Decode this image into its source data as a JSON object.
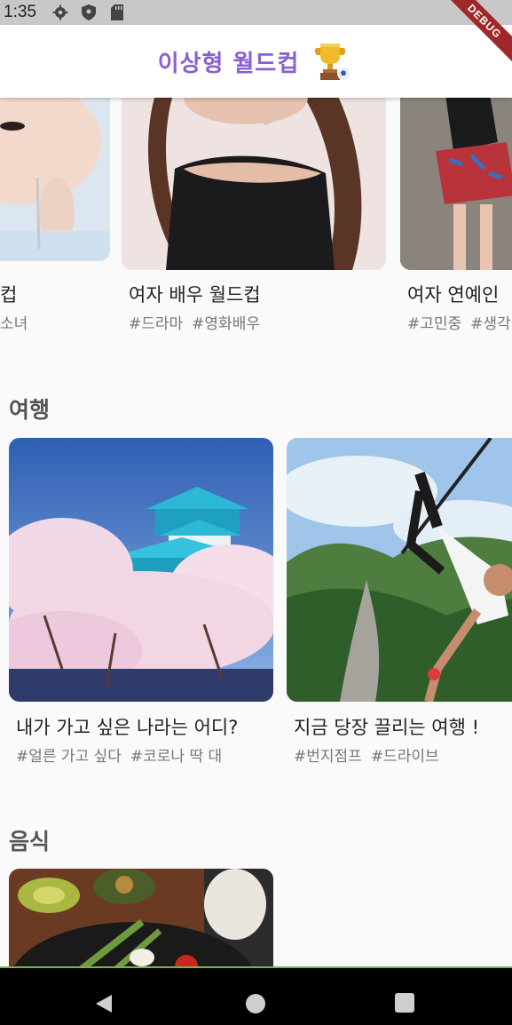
{
  "status_bar": {
    "time": "1:35",
    "icons": [
      "gear-icon",
      "shield-icon",
      "sd-card-icon"
    ]
  },
  "app_bar": {
    "title": "이상형 월드컵",
    "icon": "trophy-icon"
  },
  "debug_banner": "DEBUG",
  "colors": {
    "title": "#8a5fd0",
    "background": "#fafafa",
    "nav_accent": "#7cb342"
  },
  "top_row": [
    {
      "title": "컵",
      "tags": [
        "소녀"
      ]
    },
    {
      "title": "여자 배우 월드컵",
      "tags": [
        "#드라마",
        "#영화배우"
      ]
    },
    {
      "title": "여자 연예인",
      "tags": [
        "#고민중",
        "#생각"
      ]
    }
  ],
  "sections": [
    {
      "title": "여행",
      "cards": [
        {
          "title": "내가 가고 싶은 나라는 어디?",
          "tags": [
            "#얼른 가고 싶다",
            "#코로나 딱 대"
          ]
        },
        {
          "title": "지금 당장 끌리는 여행 !",
          "tags": [
            "#번지점프",
            "#드라이브"
          ]
        }
      ]
    },
    {
      "title": "음식",
      "cards": []
    }
  ],
  "nav_bar": {
    "buttons": [
      "back-icon",
      "home-icon",
      "recents-icon"
    ]
  }
}
